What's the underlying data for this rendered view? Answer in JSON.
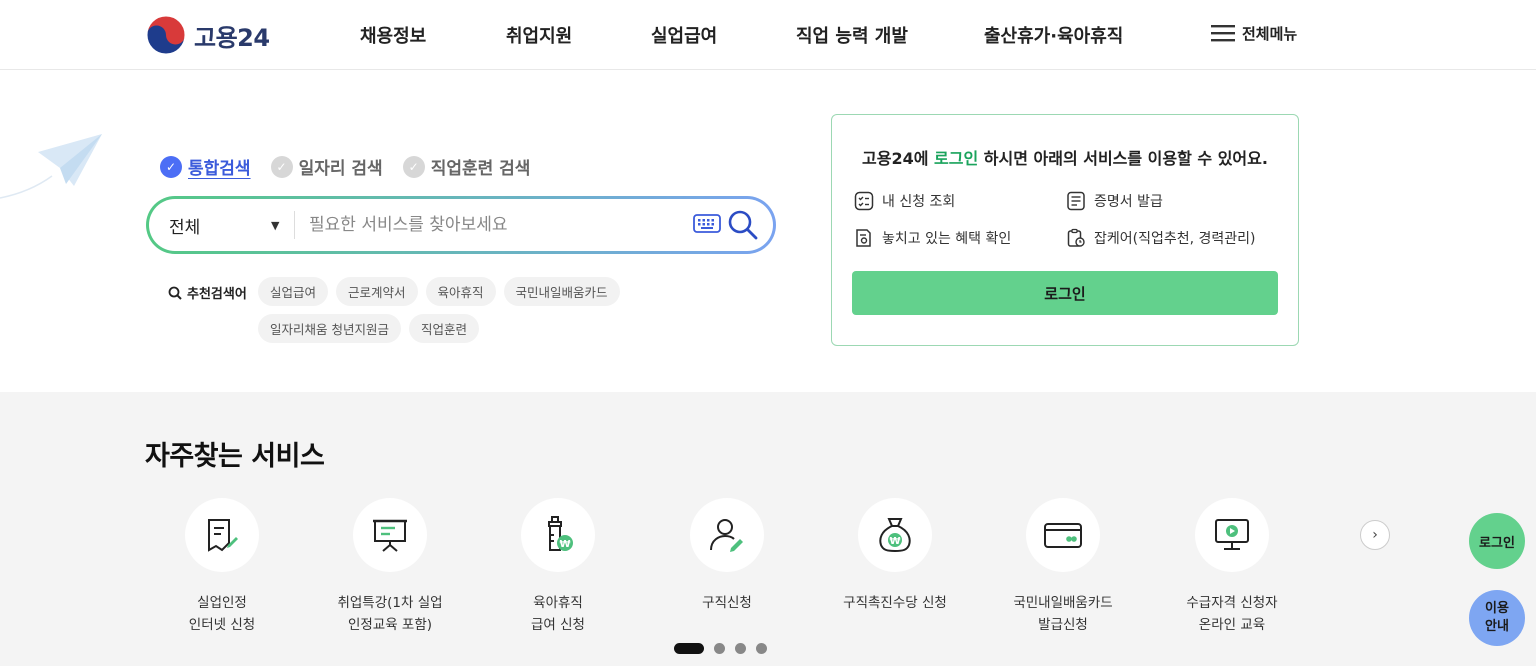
{
  "header": {
    "logo_text": "고용24",
    "nav": [
      "채용정보",
      "취업지원",
      "실업급여",
      "직업 능력 개발",
      "출산휴가·육아휴직"
    ],
    "menu_label": "전체메뉴"
  },
  "search": {
    "tabs": [
      {
        "label": "통합검색",
        "active": true
      },
      {
        "label": "일자리 검색",
        "active": false
      },
      {
        "label": "직업훈련 검색",
        "active": false
      }
    ],
    "scope": "전체",
    "placeholder": "필요한 서비스를 찾아보세요",
    "recommend_label": "추천검색어",
    "chips": [
      "실업급여",
      "근로계약서",
      "육아휴직",
      "국민내일배움카드",
      "일자리채움 청년지원금",
      "직업훈련"
    ]
  },
  "login_box": {
    "title_prefix": "고용24에 ",
    "title_highlight": "로그인",
    "title_suffix": " 하시면 아래의 서비스를 이용할 수 있어요.",
    "features": [
      "내 신청 조회",
      "증명서 발급",
      "놓치고 있는 혜택 확인",
      "잡케어(직업추천, 경력관리)"
    ],
    "button": "로그인"
  },
  "services": {
    "title": "자주찾는 서비스",
    "items": [
      {
        "line1": "실업인정",
        "line2": "인터넷 신청",
        "icon": "document-edit-icon"
      },
      {
        "line1": "취업특강(1차 실업",
        "line2": "인정교육 포함)",
        "icon": "presentation-board-icon"
      },
      {
        "line1": "육아휴직",
        "line2": "급여 신청",
        "icon": "baby-bottle-won-icon"
      },
      {
        "line1": "구직신청",
        "line2": "",
        "icon": "person-edit-icon"
      },
      {
        "line1": "구직촉진수당 신청",
        "line2": "",
        "icon": "money-bag-won-icon"
      },
      {
        "line1": "국민내일배움카드",
        "line2": "발급신청",
        "icon": "card-icon"
      },
      {
        "line1": "수급자격 신청자",
        "line2": "온라인 교육",
        "icon": "monitor-play-icon"
      }
    ]
  },
  "floating": {
    "login": "로그인",
    "guide": "이용 안내"
  },
  "colors": {
    "accent_green": "#63d18d",
    "accent_blue": "#4c6ef5",
    "highlight_green": "#1aa35c"
  }
}
